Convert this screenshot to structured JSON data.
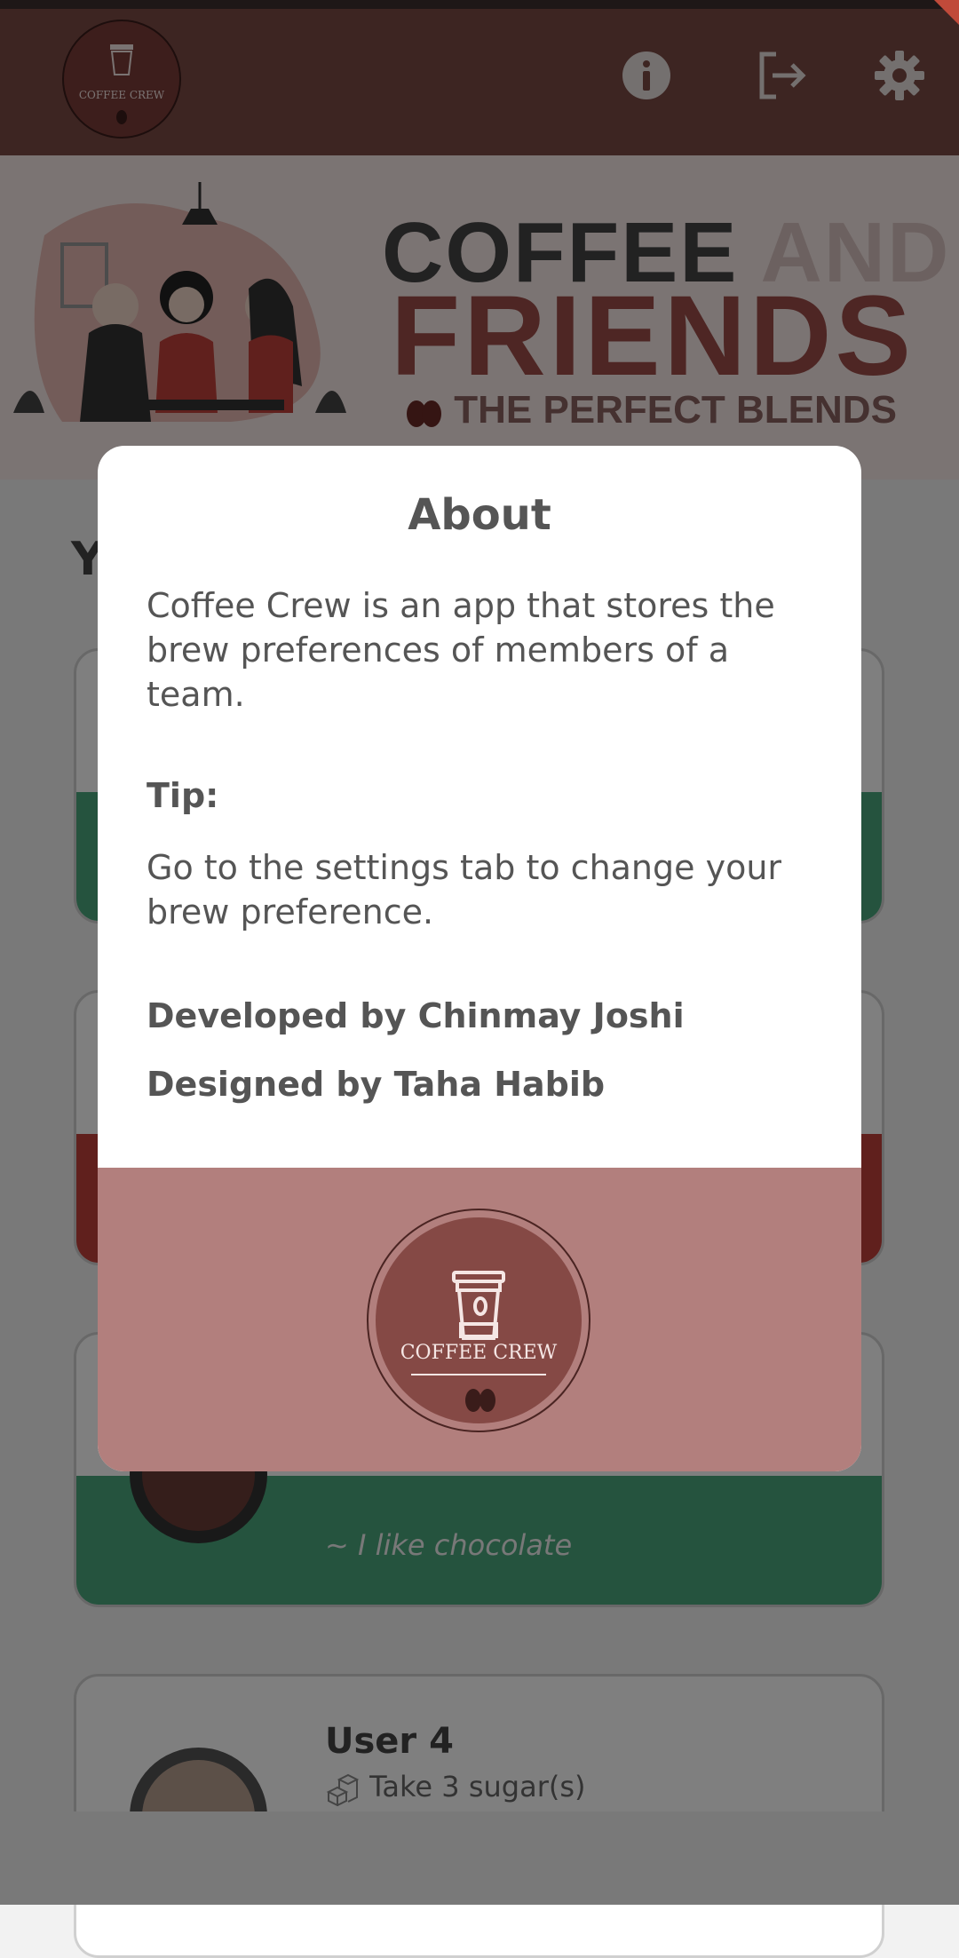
{
  "app": {
    "logo_text": "COFFEE CREW"
  },
  "banner": {
    "line1_a": "COFFEE",
    "line1_b": " AND",
    "line2": "FRIENDS",
    "line3": "THE PERFECT BLENDS"
  },
  "page": {
    "heading_partial": "Y"
  },
  "cards": [
    {
      "band_color": "#4aa77c"
    },
    {
      "band_color": "#c0403a"
    },
    {
      "band_color": "#4aa77c",
      "quote": "~ I like chocolate"
    },
    {
      "name": "User 4",
      "sugar": "Take 3 sugar(s)"
    }
  ],
  "dialog": {
    "title": "About",
    "description": "Coffee Crew is an app that stores the brew preferences of members of a team.",
    "tip_label": "Tip:",
    "tip_text": "Go to the settings tab to change your brew preference.",
    "developed_by": "Developed by Chinmay Joshi",
    "designed_by": "Designed by Taha Habib",
    "footer_logo_text": "COFFEE CREW"
  },
  "icons": {
    "info": "info-icon",
    "logout": "logout-icon",
    "settings": "gear-icon"
  },
  "colors": {
    "appbar": "#7b4a45",
    "dialog_footer": "#b27f7d",
    "accent_green": "#4aa77c",
    "accent_red": "#c0403a"
  }
}
